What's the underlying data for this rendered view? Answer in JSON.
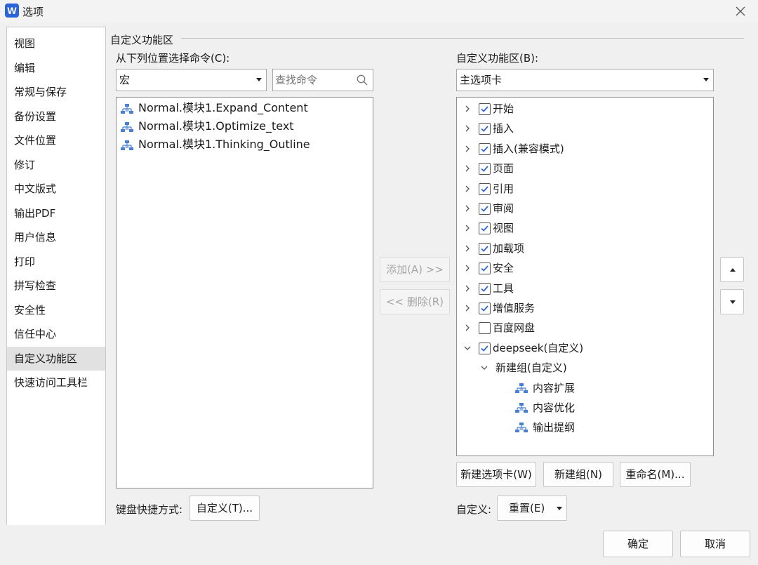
{
  "window": {
    "title": "选项",
    "app_icon_letter": "W"
  },
  "nav": {
    "items": [
      "视图",
      "编辑",
      "常规与保存",
      "备份设置",
      "文件位置",
      "修订",
      "中文版式",
      "输出PDF",
      "用户信息",
      "打印",
      "拼写检查",
      "安全性",
      "信任中心",
      "自定义功能区",
      "快速访问工具栏"
    ],
    "active": "自定义功能区"
  },
  "section": {
    "title": "自定义功能区"
  },
  "left": {
    "choose_label": "从下列位置选择命令(C):",
    "source_select": "宏",
    "search_placeholder": "查找命令",
    "commands": [
      "Normal.模块1.Expand_Content",
      "Normal.模块1.Optimize_text",
      "Normal.模块1.Thinking_Outline"
    ],
    "keyboard_label": "键盘快捷方式:",
    "customize_button": "自定义(T)..."
  },
  "middle": {
    "add_button": "添加(A) >>",
    "remove_button": "<< 删除(R)"
  },
  "right": {
    "ribbon_label": "自定义功能区(B):",
    "ribbon_select": "主选项卡",
    "tabs": [
      {
        "label": "开始",
        "checked": true
      },
      {
        "label": "插入",
        "checked": true
      },
      {
        "label": "插入(兼容模式)",
        "checked": true
      },
      {
        "label": "页面",
        "checked": true
      },
      {
        "label": "引用",
        "checked": true
      },
      {
        "label": "审阅",
        "checked": true
      },
      {
        "label": "视图",
        "checked": true
      },
      {
        "label": "加载项",
        "checked": true
      },
      {
        "label": "安全",
        "checked": true
      },
      {
        "label": "工具",
        "checked": true
      },
      {
        "label": "增值服务",
        "checked": true
      },
      {
        "label": "百度网盘",
        "checked": false
      },
      {
        "label": "deepseek(自定义)",
        "checked": true
      }
    ],
    "group_label": "新建组(自定义)",
    "group_items": [
      "内容扩展",
      "内容优化",
      "输出提纲"
    ],
    "new_tab_button": "新建选项卡(W)",
    "new_group_button": "新建组(N)",
    "rename_button": "重命名(M)...",
    "customize_label": "自定义:",
    "reset_button": "重置(E)"
  },
  "footer": {
    "ok_button": "确定",
    "cancel_button": "取消"
  },
  "colors": {
    "accent": "#2b63d9",
    "macro_icon": "#4a7fd0",
    "active_nav": "#e1e1e1"
  }
}
